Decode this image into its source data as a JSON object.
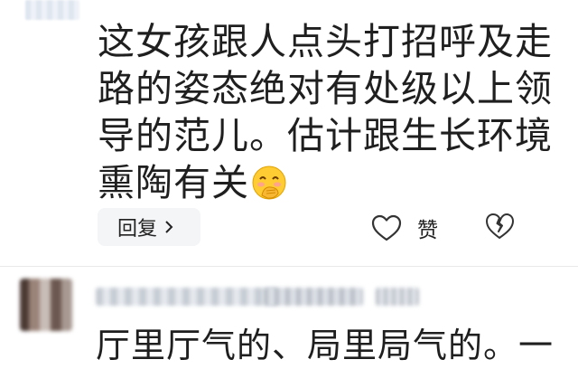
{
  "comment": {
    "text": "这女孩跟人点头打招呼及走路的姿态绝对有处级以上领导的范儿。估计跟生长环境熏陶有关",
    "emoji": "grinning-face-with-hand-over-mouth"
  },
  "actions": {
    "reply_label": "回复",
    "like_label": "赞"
  },
  "next_comment": {
    "text": "厅里厅气的、局里局气的。一"
  }
}
